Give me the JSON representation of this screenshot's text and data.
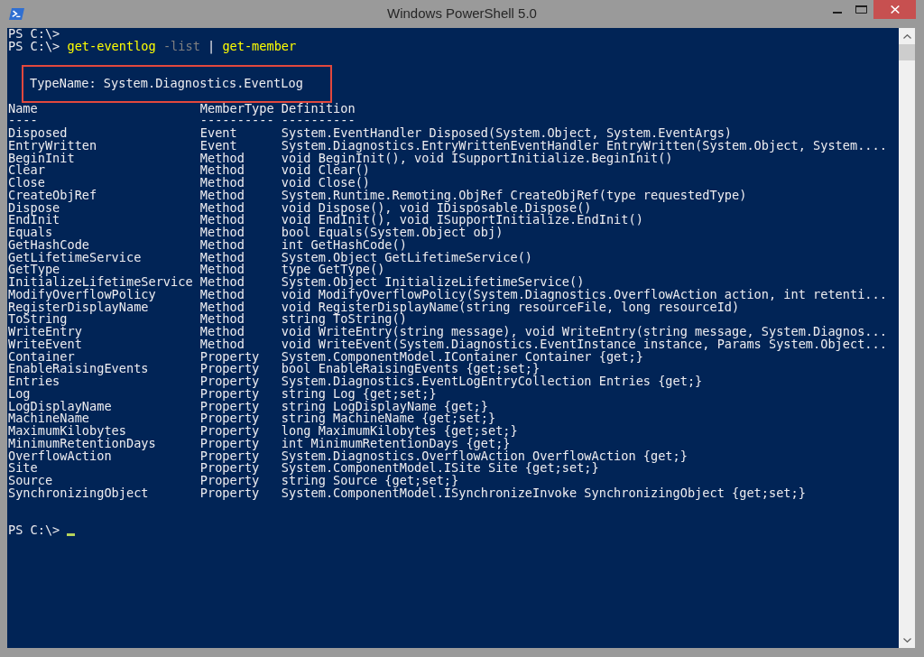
{
  "window": {
    "title": "Windows PowerShell 5.0"
  },
  "console": {
    "history": [
      {
        "prompt": "PS C:\\>"
      },
      {
        "prompt": "PS C:\\>",
        "command": [
          {
            "text": "get-eventlog",
            "kind": "command"
          },
          {
            "text": "-list",
            "kind": "parameter"
          },
          {
            "text": "|",
            "kind": "operator"
          },
          {
            "text": "get-member",
            "kind": "command"
          }
        ]
      }
    ],
    "type_name": {
      "text": "TypeName: System.Diagnostics.EventLog",
      "highlighted": true
    },
    "table": {
      "columns": [
        {
          "header": "Name",
          "underline": "----"
        },
        {
          "header": "MemberType",
          "underline": "----------"
        },
        {
          "header": "Definition",
          "underline": "----------"
        }
      ],
      "rows": [
        {
          "name": "Disposed",
          "member_type": "Event",
          "definition": "System.EventHandler Disposed(System.Object, System.EventArgs)"
        },
        {
          "name": "EntryWritten",
          "member_type": "Event",
          "definition": "System.Diagnostics.EntryWrittenEventHandler EntryWritten(System.Object, System...."
        },
        {
          "name": "BeginInit",
          "member_type": "Method",
          "definition": "void BeginInit(), void ISupportInitialize.BeginInit()"
        },
        {
          "name": "Clear",
          "member_type": "Method",
          "definition": "void Clear()"
        },
        {
          "name": "Close",
          "member_type": "Method",
          "definition": "void Close()"
        },
        {
          "name": "CreateObjRef",
          "member_type": "Method",
          "definition": "System.Runtime.Remoting.ObjRef CreateObjRef(type requestedType)"
        },
        {
          "name": "Dispose",
          "member_type": "Method",
          "definition": "void Dispose(), void IDisposable.Dispose()"
        },
        {
          "name": "EndInit",
          "member_type": "Method",
          "definition": "void EndInit(), void ISupportInitialize.EndInit()"
        },
        {
          "name": "Equals",
          "member_type": "Method",
          "definition": "bool Equals(System.Object obj)"
        },
        {
          "name": "GetHashCode",
          "member_type": "Method",
          "definition": "int GetHashCode()"
        },
        {
          "name": "GetLifetimeService",
          "member_type": "Method",
          "definition": "System.Object GetLifetimeService()"
        },
        {
          "name": "GetType",
          "member_type": "Method",
          "definition": "type GetType()"
        },
        {
          "name": "InitializeLifetimeService",
          "member_type": "Method",
          "definition": "System.Object InitializeLifetimeService()"
        },
        {
          "name": "ModifyOverflowPolicy",
          "member_type": "Method",
          "definition": "void ModifyOverflowPolicy(System.Diagnostics.OverflowAction action, int retenti..."
        },
        {
          "name": "RegisterDisplayName",
          "member_type": "Method",
          "definition": "void RegisterDisplayName(string resourceFile, long resourceId)"
        },
        {
          "name": "ToString",
          "member_type": "Method",
          "definition": "string ToString()"
        },
        {
          "name": "WriteEntry",
          "member_type": "Method",
          "definition": "void WriteEntry(string message), void WriteEntry(string message, System.Diagnos..."
        },
        {
          "name": "WriteEvent",
          "member_type": "Method",
          "definition": "void WriteEvent(System.Diagnostics.EventInstance instance, Params System.Object..."
        },
        {
          "name": "Container",
          "member_type": "Property",
          "definition": "System.ComponentModel.IContainer Container {get;}"
        },
        {
          "name": "EnableRaisingEvents",
          "member_type": "Property",
          "definition": "bool EnableRaisingEvents {get;set;}"
        },
        {
          "name": "Entries",
          "member_type": "Property",
          "definition": "System.Diagnostics.EventLogEntryCollection Entries {get;}"
        },
        {
          "name": "Log",
          "member_type": "Property",
          "definition": "string Log {get;set;}"
        },
        {
          "name": "LogDisplayName",
          "member_type": "Property",
          "definition": "string LogDisplayName {get;}"
        },
        {
          "name": "MachineName",
          "member_type": "Property",
          "definition": "string MachineName {get;set;}"
        },
        {
          "name": "MaximumKilobytes",
          "member_type": "Property",
          "definition": "long MaximumKilobytes {get;set;}"
        },
        {
          "name": "MinimumRetentionDays",
          "member_type": "Property",
          "definition": "int MinimumRetentionDays {get;}"
        },
        {
          "name": "OverflowAction",
          "member_type": "Property",
          "definition": "System.Diagnostics.OverflowAction OverflowAction {get;}"
        },
        {
          "name": "Site",
          "member_type": "Property",
          "definition": "System.ComponentModel.ISite Site {get;set;}"
        },
        {
          "name": "Source",
          "member_type": "Property",
          "definition": "string Source {get;set;}"
        },
        {
          "name": "SynchronizingObject",
          "member_type": "Property",
          "definition": "System.ComponentModel.ISynchronizeInvoke SynchronizingObject {get;set;}"
        }
      ]
    },
    "current_prompt": {
      "prompt": "PS C:\\>",
      "cursor": true
    }
  }
}
